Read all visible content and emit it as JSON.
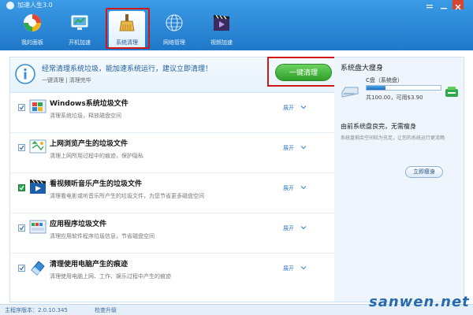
{
  "app": {
    "title": "加速人生3.0"
  },
  "toolbar": {
    "items": [
      {
        "label": "我的面板",
        "icon": "dashboard-icon"
      },
      {
        "label": "开机加速",
        "icon": "monitor-icon"
      },
      {
        "label": "系统清理",
        "icon": "broom-icon"
      },
      {
        "label": "网络管理",
        "icon": "globe-icon"
      },
      {
        "label": "视频加速",
        "icon": "film-icon"
      }
    ],
    "active_index": 2
  },
  "notice": {
    "title": "经常清理系统垃圾，能加速系统运行，建议立即清理！",
    "subtitle": "一键清理  |  清理完毕",
    "clean_button": "一键清理"
  },
  "rows": [
    {
      "title": "Windows系统垃圾文件",
      "subtitle": "清理系统垃圾，释放磁盘空间",
      "expand": "展开",
      "icon": "windows-icon",
      "checked": true
    },
    {
      "title": "上网浏览产生的垃圾文件",
      "subtitle": "清理上网所用过程中的痕迹，保护隐私",
      "expand": "展开",
      "icon": "browser-icon",
      "checked": true
    },
    {
      "title": "看视频听音乐产生的垃圾文件",
      "subtitle": "清理看电影或听音乐所产生的垃圾文件，为您节省更多磁盘空间",
      "expand": "展开",
      "icon": "media-icon",
      "checked": true
    },
    {
      "title": "应用程序垃圾文件",
      "subtitle": "清理应用软件程序垃圾信息，节省磁盘空间",
      "expand": "展开",
      "icon": "application-icon",
      "checked": true
    },
    {
      "title": "清理使用电脑产生的痕迹",
      "subtitle": "清理使用电脑上网、工作、娱乐过程中产生的痕迹",
      "expand": "展开",
      "icon": "eraser-icon",
      "checked": true
    }
  ],
  "side": {
    "title": "系统盘大瘦身",
    "drive_name": "C盘（系统盘）",
    "drive_info": "共100.00，可用$3.90",
    "usage_fraction": 0.25,
    "slim_title": "由前系统盘良完，无需瘦身",
    "slim_subtitle": "系统盘剩余空间较为充足，让您的系统运行更流畅",
    "slim_button": "立即瘦身"
  },
  "status": {
    "version": "主程序版本：2.0.10.345",
    "update": "检查升级"
  },
  "watermark": "sanwen.net",
  "colors": {
    "accent": "#1f78c8",
    "highlight": "#d11616",
    "button_green": "#2f9e2b"
  }
}
